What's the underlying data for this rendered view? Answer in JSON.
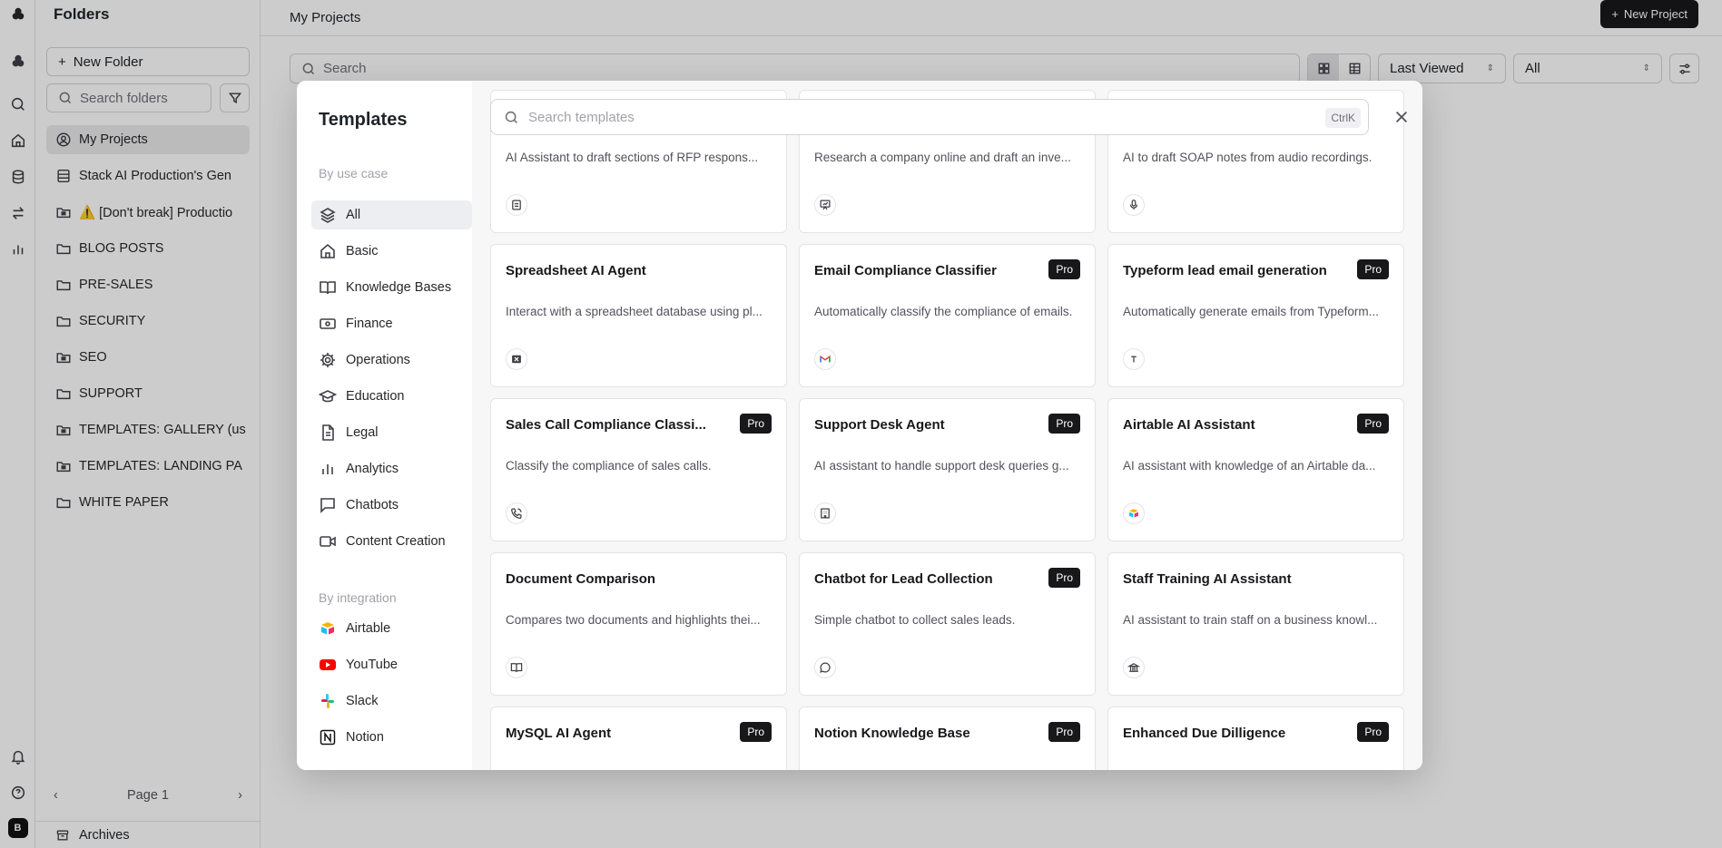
{
  "folders": {
    "title": "Folders",
    "new_folder_label": "New Folder",
    "search_placeholder": "Search folders",
    "items": [
      {
        "label": "My Projects",
        "icon": "user-circle-icon"
      },
      {
        "label": "Stack AI Production's Gen",
        "icon": "database-icon"
      },
      {
        "label": "⚠️ [Don't break] Productio",
        "icon": "folder-lock-icon"
      },
      {
        "label": "BLOG POSTS",
        "icon": "folder-icon"
      },
      {
        "label": "PRE-SALES",
        "icon": "folder-icon"
      },
      {
        "label": "SECURITY",
        "icon": "folder-icon"
      },
      {
        "label": "SEO",
        "icon": "folder-lock-icon"
      },
      {
        "label": "SUPPORT",
        "icon": "folder-icon"
      },
      {
        "label": "TEMPLATES: GALLERY (us",
        "icon": "folder-lock-icon"
      },
      {
        "label": "TEMPLATES: LANDING PA",
        "icon": "folder-lock-icon"
      },
      {
        "label": "WHITE PAPER",
        "icon": "folder-icon"
      }
    ],
    "page_label": "Page 1",
    "archives_label": "Archives"
  },
  "rail": {
    "avatar_letter": "B"
  },
  "main": {
    "breadcrumb": "My Projects",
    "new_project_label": "New Project",
    "search_placeholder": "Search",
    "sort_value": "Last Viewed",
    "filter_value": "All"
  },
  "modal": {
    "title": "Templates",
    "by_use_case_label": "By use case",
    "by_integration_label": "By integration",
    "categories": [
      {
        "label": "All",
        "icon": "layers-icon"
      },
      {
        "label": "Basic",
        "icon": "home-icon"
      },
      {
        "label": "Knowledge Bases",
        "icon": "book-open-icon"
      },
      {
        "label": "Finance",
        "icon": "banknote-icon"
      },
      {
        "label": "Operations",
        "icon": "gear-icon"
      },
      {
        "label": "Education",
        "icon": "graduation-cap-icon"
      },
      {
        "label": "Legal",
        "icon": "file-text-icon"
      },
      {
        "label": "Analytics",
        "icon": "bar-chart-icon"
      },
      {
        "label": "Chatbots",
        "icon": "message-square-icon"
      },
      {
        "label": "Content Creation",
        "icon": "video-icon"
      }
    ],
    "integrations": [
      {
        "label": "Airtable",
        "icon": "airtable-logo-icon"
      },
      {
        "label": "YouTube",
        "icon": "youtube-logo-icon"
      },
      {
        "label": "Slack",
        "icon": "slack-logo-icon"
      },
      {
        "label": "Notion",
        "icon": "notion-logo-icon"
      }
    ],
    "search_placeholder": "Search templates",
    "search_shortcut": "CtrlK",
    "pro_label": "Pro",
    "cards": [
      {
        "title": "",
        "desc": "AI Assistant to draft sections of RFP respons...",
        "pro": false,
        "icon": "document-icon"
      },
      {
        "title": "",
        "desc": "Research a company online and draft an inve...",
        "pro": false,
        "icon": "presentation-icon"
      },
      {
        "title": "",
        "desc": "AI to draft SOAP notes from audio recordings.",
        "pro": false,
        "icon": "microphone-icon"
      },
      {
        "title": "Spreadsheet AI Agent",
        "desc": "Interact with a spreadsheet database using pl...",
        "pro": false,
        "icon": "excel-logo-icon"
      },
      {
        "title": "Email Compliance Classifier",
        "desc": "Automatically classify the compliance of emails.",
        "pro": true,
        "icon": "gmail-logo-icon"
      },
      {
        "title": "Typeform lead email generation",
        "desc": "Automatically generate emails from Typeform...",
        "pro": true,
        "icon": "typeform-logo-icon"
      },
      {
        "title": "Sales Call Compliance Classi...",
        "desc": "Classify the compliance of sales calls.",
        "pro": true,
        "icon": "phone-call-icon"
      },
      {
        "title": "Support Desk Agent",
        "desc": "AI assistant to handle support desk queries g...",
        "pro": true,
        "icon": "building-icon"
      },
      {
        "title": "Airtable AI Assistant",
        "desc": "AI assistant with knowledge of an Airtable da...",
        "pro": true,
        "icon": "airtable-logo-icon"
      },
      {
        "title": "Document Comparison",
        "desc": "Compares two documents and highlights thei...",
        "pro": false,
        "icon": "book-open-icon"
      },
      {
        "title": "Chatbot for Lead Collection",
        "desc": "Simple chatbot to collect sales leads.",
        "pro": true,
        "icon": "message-circle-icon"
      },
      {
        "title": "Staff Training AI Assistant",
        "desc": "AI assistant to train staff on a business knowl...",
        "pro": false,
        "icon": "landmark-icon"
      },
      {
        "title": "MySQL AI Agent",
        "desc": "",
        "pro": true,
        "icon": ""
      },
      {
        "title": "Notion Knowledge Base",
        "desc": "",
        "pro": true,
        "icon": ""
      },
      {
        "title": "Enhanced Due Dilligence",
        "desc": "",
        "pro": true,
        "icon": ""
      }
    ]
  }
}
